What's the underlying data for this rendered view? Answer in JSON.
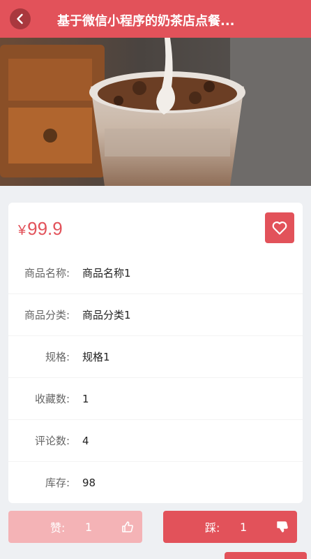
{
  "header": {
    "title": "基于微信小程序的奶茶店点餐...",
    "back_icon": "chevron-left-icon",
    "accent": "#e2525a"
  },
  "hero": {
    "image": "milk-tea-cup-photo"
  },
  "product": {
    "currency": "¥",
    "price": "99.9",
    "favorite_icon": "heart-icon",
    "fields": [
      {
        "label": "商品名称:",
        "value": "商品名称1"
      },
      {
        "label": "商品分类:",
        "value": "商品分类1"
      },
      {
        "label": "规格:",
        "value": "规格1"
      },
      {
        "label": "收藏数:",
        "value": "1"
      },
      {
        "label": "评论数:",
        "value": "4"
      },
      {
        "label": "库存:",
        "value": "98"
      }
    ]
  },
  "actions": {
    "like_label": "赞:",
    "like_count": "1",
    "like_icon": "thumbs-up-icon",
    "dislike_label": "踩:",
    "dislike_count": "1",
    "dislike_icon": "thumbs-down-icon"
  }
}
